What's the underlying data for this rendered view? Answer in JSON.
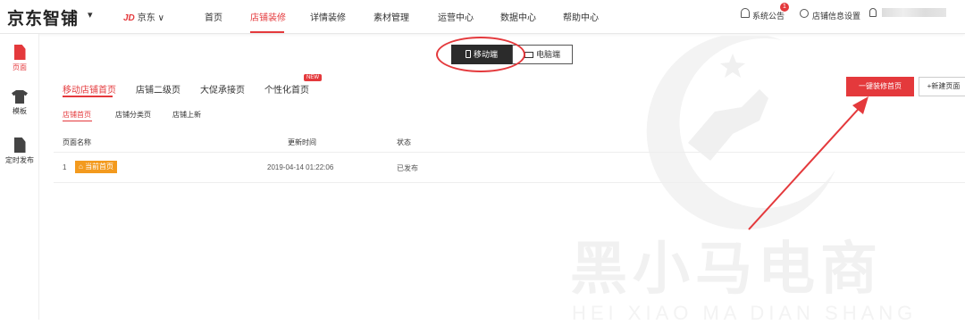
{
  "brand": {
    "logo": "京东智铺",
    "caret": "▾",
    "shop_prefix": "JD",
    "shop_name": "京东 ∨"
  },
  "nav": [
    "首页",
    "店铺装修",
    "详情装修",
    "素材管理",
    "运营中心",
    "数据中心",
    "帮助中心"
  ],
  "header_right": {
    "notice": "系统公告",
    "notice_count": "1",
    "settings": "店铺信息设置"
  },
  "sidebar": [
    {
      "label": "页面",
      "icon": "page-icon"
    },
    {
      "label": "模板",
      "icon": "shirt-icon"
    },
    {
      "label": "定时发布",
      "icon": "publish-icon"
    }
  ],
  "device_switch": {
    "mobile": "移动端",
    "pc": "电脑端"
  },
  "tabs_level1": [
    "移动店铺首页",
    "店铺二级页",
    "大促承接页",
    "个性化首页"
  ],
  "new_badge": "NEW",
  "tabs_level2": [
    "店铺首页",
    "店铺分类页",
    "店铺上新"
  ],
  "buttons": {
    "one_click": "一键装修首页",
    "new_page": "+新建页面"
  },
  "table": {
    "headers": [
      "页面名称",
      "更新时间",
      "状态"
    ],
    "rows": [
      {
        "index": "1",
        "name": "当前首页",
        "updated": "2019-04-14 01:22:06",
        "status": "已发布"
      }
    ]
  },
  "watermark": {
    "text": "黑小马电商",
    "sub": "HEI XIAO MA DIAN SHANG"
  },
  "colors": {
    "accent": "#e4393c",
    "tag": "#f39a1e"
  }
}
